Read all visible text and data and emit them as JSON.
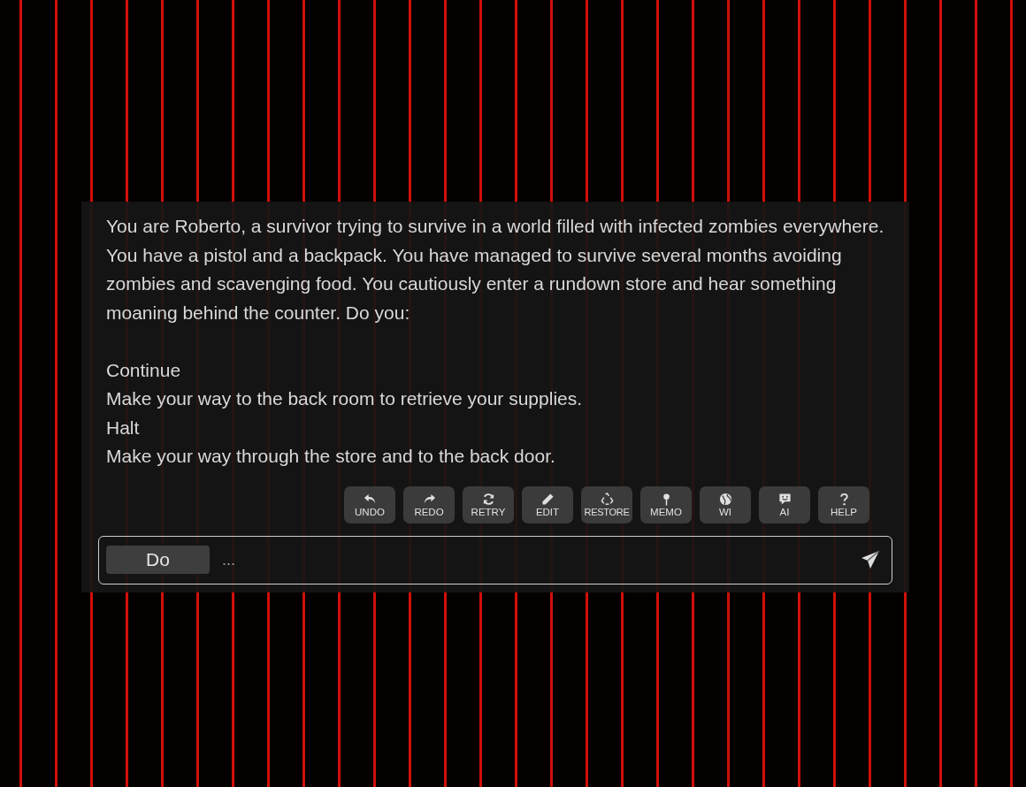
{
  "story": [
    "You are Roberto, a survivor trying to survive in a world filled with infected zombies everywhere. You have a pistol and a backpack. You have managed to survive several months avoiding zombies and scavenging food. You cautiously enter a rundown store and hear something moaning behind the counter. Do you:",
    "Continue",
    "Make your way to the back room to retrieve your supplies.",
    "Halt",
    "Make your way through the store and to the back door."
  ],
  "actions": [
    {
      "kind": "undo",
      "label": "UNDO"
    },
    {
      "kind": "redo",
      "label": "REDO"
    },
    {
      "kind": "retry",
      "label": "RETRY"
    },
    {
      "kind": "edit",
      "label": "EDIT"
    },
    {
      "kind": "restore",
      "label": "RESTORE"
    },
    {
      "kind": "memo",
      "label": "MEMO"
    },
    {
      "kind": "wi",
      "label": "WI"
    },
    {
      "kind": "ai",
      "label": "AI"
    },
    {
      "kind": "help",
      "label": "HELP"
    }
  ],
  "input": {
    "mode": "Do",
    "placeholder": "..."
  }
}
